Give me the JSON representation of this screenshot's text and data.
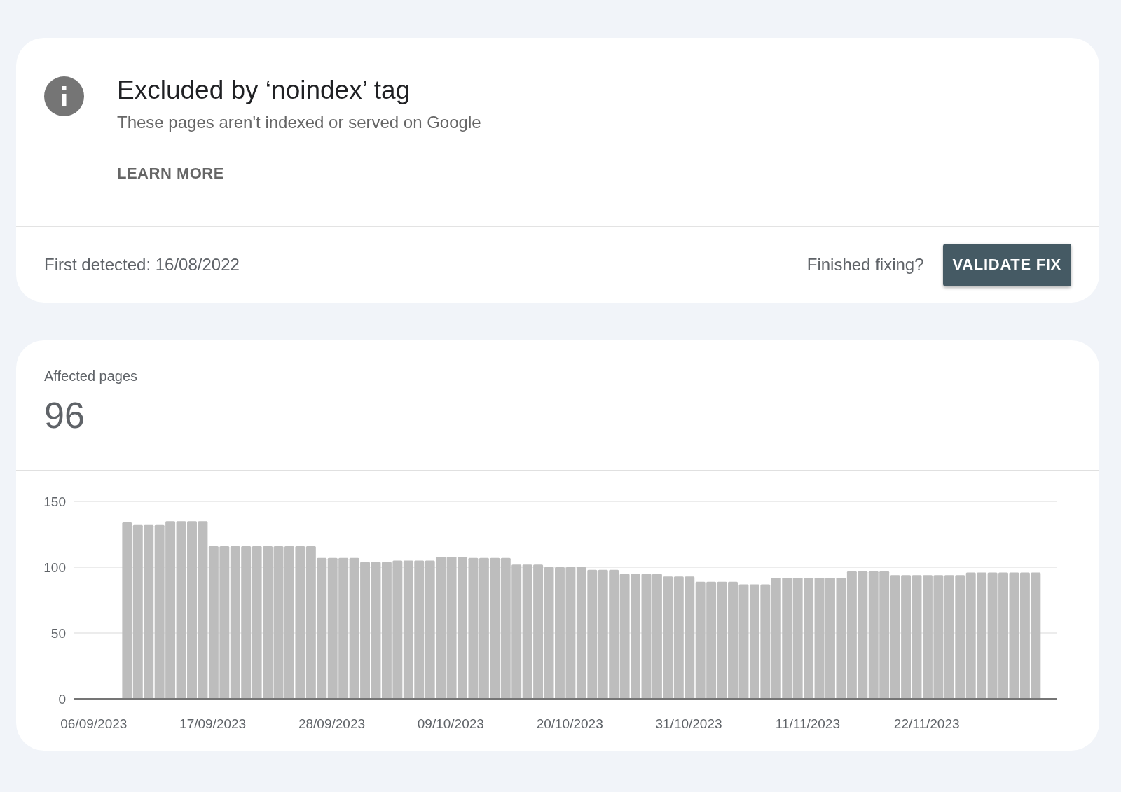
{
  "issue": {
    "title": "Excluded by ‘noindex’ tag",
    "description": "These pages aren't indexed or served on Google",
    "learn_more": "LEARN MORE",
    "first_detected": "First detected: 16/08/2022",
    "fix_prompt": "Finished fixing?",
    "validate_button": "VALIDATE FIX"
  },
  "affected": {
    "label": "Affected pages",
    "count": "96",
    "chart_data": {
      "type": "bar",
      "categories": [
        "06/09/2023",
        null,
        null,
        null,
        null,
        null,
        null,
        null,
        null,
        null,
        null,
        "17/09/2023",
        null,
        null,
        null,
        null,
        null,
        null,
        null,
        null,
        null,
        null,
        "28/09/2023",
        null,
        null,
        null,
        null,
        null,
        null,
        null,
        null,
        null,
        null,
        "09/10/2023",
        null,
        null,
        null,
        null,
        null,
        null,
        null,
        null,
        null,
        null,
        "20/10/2023",
        null,
        null,
        null,
        null,
        null,
        null,
        null,
        null,
        null,
        null,
        "31/10/2023",
        null,
        null,
        null,
        null,
        null,
        null,
        null,
        null,
        null,
        null,
        "11/11/2023",
        null,
        null,
        null,
        null,
        null,
        null,
        null,
        null,
        null,
        null,
        "22/11/2023",
        null,
        null,
        null,
        null,
        null,
        null,
        null,
        null,
        null,
        null,
        null
      ],
      "series": [
        {
          "color": "#bdbdbd",
          "values": [
            null,
            null,
            null,
            134,
            132,
            132,
            132,
            135,
            135,
            135,
            135,
            116,
            116,
            116,
            116,
            116,
            116,
            116,
            116,
            116,
            116,
            107,
            107,
            107,
            107,
            104,
            104,
            104,
            105,
            105,
            105,
            105,
            108,
            108,
            108,
            107,
            107,
            107,
            107,
            102,
            102,
            102,
            100,
            100,
            100,
            100,
            98,
            98,
            98,
            95,
            95,
            95,
            95,
            93,
            93,
            93,
            89,
            89,
            89,
            89,
            87,
            87,
            87,
            92,
            92,
            92,
            92,
            92,
            92,
            92,
            97,
            97,
            97,
            97,
            94,
            94,
            94,
            94,
            94,
            94,
            94,
            96,
            96,
            96,
            96,
            96,
            96,
            96,
            null
          ]
        }
      ],
      "ylim": [
        0,
        150
      ],
      "yticks": [
        0,
        50,
        100,
        150
      ]
    }
  }
}
